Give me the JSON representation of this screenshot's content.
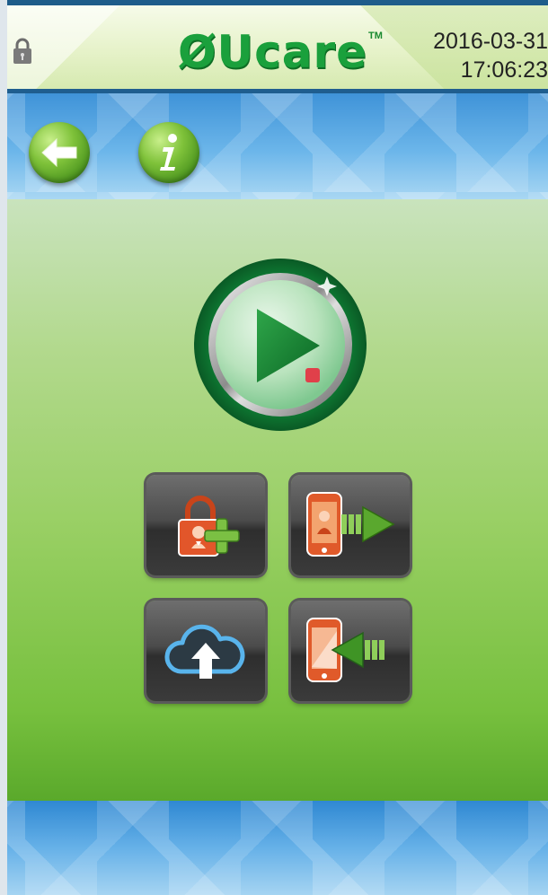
{
  "header": {
    "logo_text": "ØUcare",
    "trademark": "TM",
    "date": "2016-03-31",
    "time": "17:06:23"
  },
  "toolbar": {
    "back_icon": "back-arrow-icon",
    "info_icon": "info-icon"
  },
  "main": {
    "play_icon": "play-record-icon",
    "tiles": [
      {
        "icon": "add-patient-icon"
      },
      {
        "icon": "export-to-phone-icon"
      },
      {
        "icon": "cloud-upload-icon"
      },
      {
        "icon": "import-from-phone-icon"
      }
    ]
  },
  "colors": {
    "header_border": "#1f5e8f",
    "brand_green": "#1aa03c",
    "button_green": "#7fc23a",
    "tile_orange": "#d9531e"
  }
}
